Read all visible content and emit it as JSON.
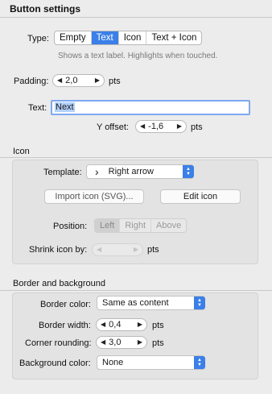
{
  "title": "Button settings",
  "type": {
    "label": "Type:",
    "options": [
      "Empty",
      "Text",
      "Icon",
      "Text + Icon"
    ],
    "selected": "Text",
    "hint": "Shows a text label. Highlights when touched."
  },
  "padding": {
    "label": "Padding:",
    "value": "2,0",
    "unit": "pts"
  },
  "text": {
    "label": "Text:",
    "value": "Next"
  },
  "y_offset": {
    "label": "Y offset:",
    "value": "-1,6",
    "unit": "pts"
  },
  "icon": {
    "title": "Icon",
    "template_label": "Template:",
    "template_value": "Right arrow",
    "import_button": "Import icon (SVG)...",
    "edit_button": "Edit icon",
    "position_label": "Position:",
    "position_options": [
      "Left",
      "Right",
      "Above"
    ],
    "position_selected": "Left",
    "shrink_label": "Shrink icon by:",
    "shrink_unit": "pts"
  },
  "border": {
    "title": "Border and background",
    "border_color_label": "Border color:",
    "border_color_value": "Same as content",
    "border_width_label": "Border width:",
    "border_width_value": "0,4",
    "border_width_unit": "pts",
    "corner_label": "Corner rounding:",
    "corner_value": "3,0",
    "corner_unit": "pts",
    "bg_label": "Background color:",
    "bg_value": "None"
  },
  "colors": {
    "accent": "#3b7fe8",
    "field_focus": "#7ea9f0"
  }
}
